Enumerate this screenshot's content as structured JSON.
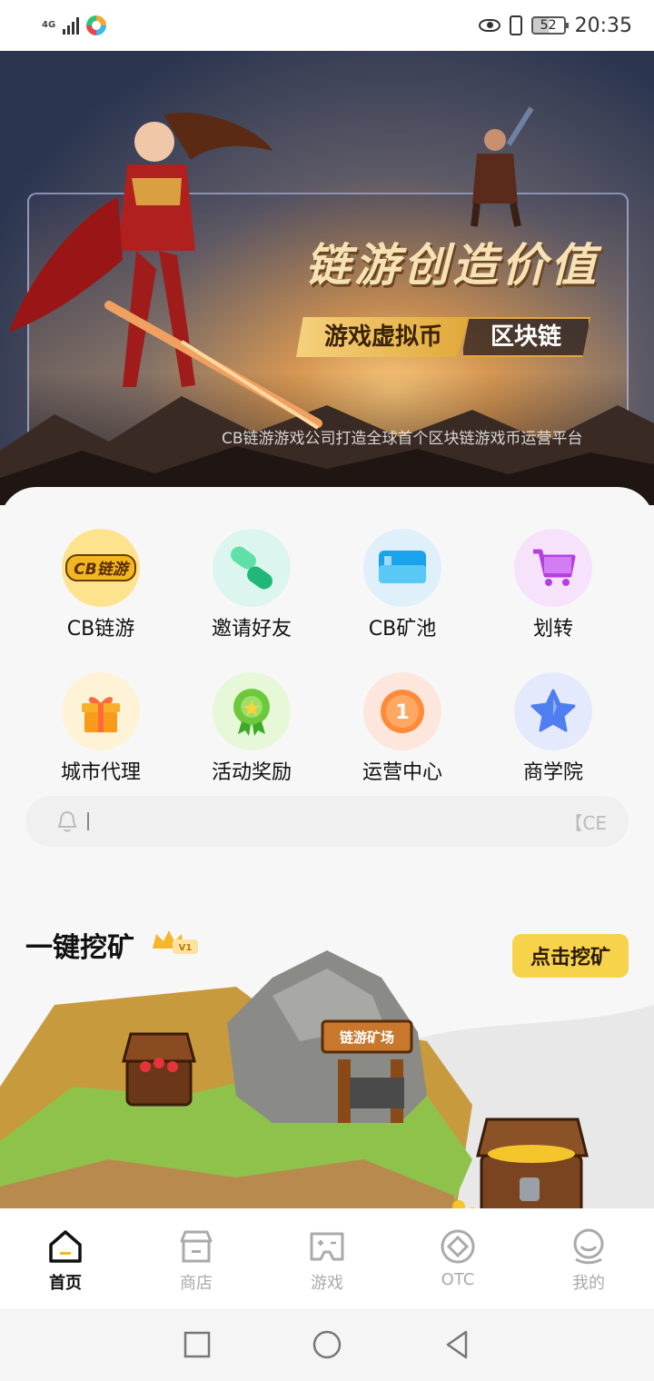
{
  "status_bar": {
    "network": "4G",
    "battery": "52",
    "time": "20:35"
  },
  "banner": {
    "title": "链游创造价值",
    "tag_left": "游戏虚拟币",
    "tag_right": "区块链",
    "subtitle": "CB链游游戏公司打造全球首个区块链游戏币运营平台"
  },
  "menu": {
    "items": [
      {
        "label": "CB链游",
        "icon": "cb-game-logo-icon",
        "logo_text": "CB链游"
      },
      {
        "label": "邀请好友",
        "icon": "link-icon"
      },
      {
        "label": "CB矿池",
        "icon": "card-icon"
      },
      {
        "label": "划转",
        "icon": "cart-icon"
      },
      {
        "label": "城市代理",
        "icon": "gift-icon"
      },
      {
        "label": "活动奖励",
        "icon": "medal-icon"
      },
      {
        "label": "运营中心",
        "icon": "number-one-coin-icon"
      },
      {
        "label": "商学院",
        "icon": "star-icon"
      }
    ]
  },
  "notice": {
    "text": "【CE"
  },
  "mining": {
    "title": "一键挖矿",
    "badge": "V1",
    "button_label": "点击挖矿",
    "sign_text": "链游矿场"
  },
  "bottom_nav": {
    "items": [
      {
        "label": "首页",
        "icon": "home-icon",
        "active": true
      },
      {
        "label": "商店",
        "icon": "shop-icon",
        "active": false
      },
      {
        "label": "游戏",
        "icon": "gamepad-icon",
        "active": false
      },
      {
        "label": "OTC",
        "icon": "otc-icon",
        "active": false
      },
      {
        "label": "我的",
        "icon": "profile-icon",
        "active": false
      }
    ]
  },
  "colors": {
    "accent": "#f7d34b",
    "text": "#111111",
    "inactive": "#aaaaaa"
  }
}
